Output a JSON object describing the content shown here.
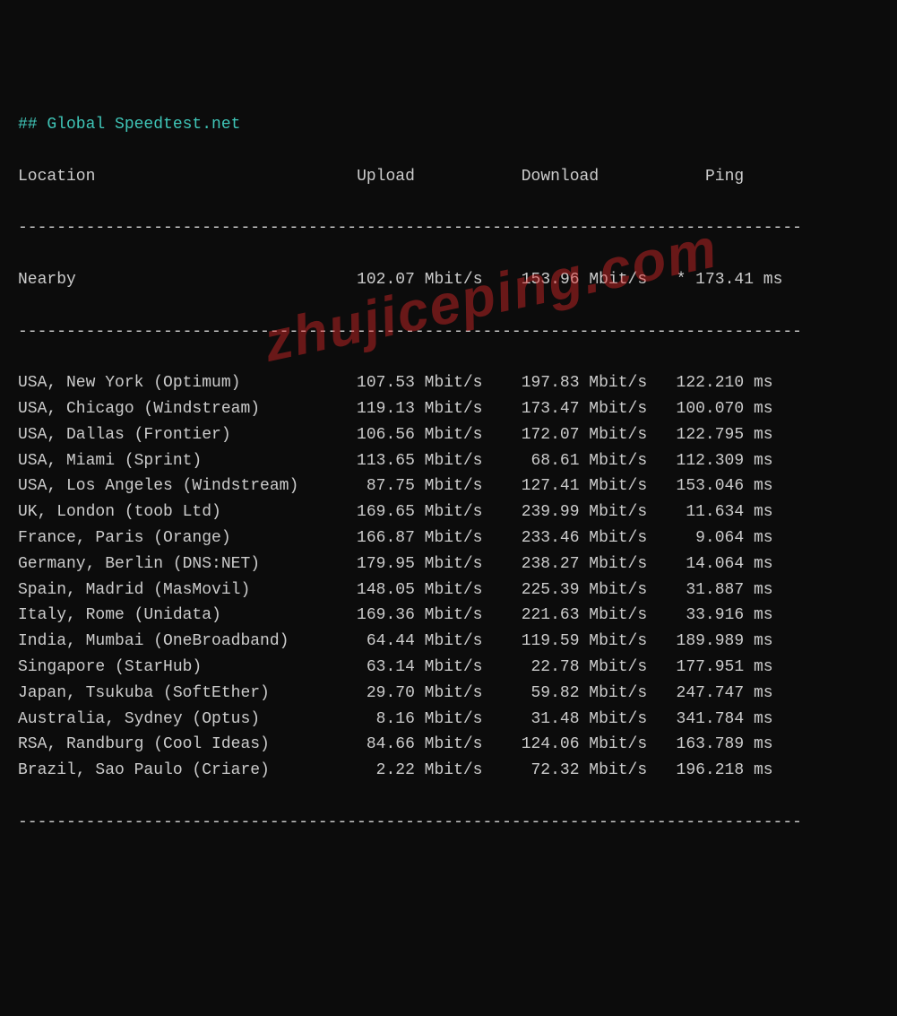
{
  "title": "## Global Speedtest.net",
  "headers": {
    "location": "Location",
    "upload": "Upload",
    "download": "Download",
    "ping": "Ping"
  },
  "nearby": {
    "label": "Nearby",
    "upload": "102.07 Mbit/s",
    "download": "153.96 Mbit/s",
    "ping": "* 173.41 ms"
  },
  "rows": [
    {
      "location": "USA, New York (Optimum)",
      "upload": "107.53 Mbit/s",
      "download": "197.83 Mbit/s",
      "ping": "122.210 ms"
    },
    {
      "location": "USA, Chicago (Windstream)",
      "upload": "119.13 Mbit/s",
      "download": "173.47 Mbit/s",
      "ping": "100.070 ms"
    },
    {
      "location": "USA, Dallas (Frontier)",
      "upload": "106.56 Mbit/s",
      "download": "172.07 Mbit/s",
      "ping": "122.795 ms"
    },
    {
      "location": "USA, Miami (Sprint)",
      "upload": "113.65 Mbit/s",
      "download": "68.61 Mbit/s",
      "ping": "112.309 ms"
    },
    {
      "location": "USA, Los Angeles (Windstream)",
      "upload": "87.75 Mbit/s",
      "download": "127.41 Mbit/s",
      "ping": "153.046 ms"
    },
    {
      "location": "UK, London (toob Ltd)",
      "upload": "169.65 Mbit/s",
      "download": "239.99 Mbit/s",
      "ping": "11.634 ms"
    },
    {
      "location": "France, Paris (Orange)",
      "upload": "166.87 Mbit/s",
      "download": "233.46 Mbit/s",
      "ping": "9.064 ms"
    },
    {
      "location": "Germany, Berlin (DNS:NET)",
      "upload": "179.95 Mbit/s",
      "download": "238.27 Mbit/s",
      "ping": "14.064 ms"
    },
    {
      "location": "Spain, Madrid (MasMovil)",
      "upload": "148.05 Mbit/s",
      "download": "225.39 Mbit/s",
      "ping": "31.887 ms"
    },
    {
      "location": "Italy, Rome (Unidata)",
      "upload": "169.36 Mbit/s",
      "download": "221.63 Mbit/s",
      "ping": "33.916 ms"
    },
    {
      "location": "India, Mumbai (OneBroadband)",
      "upload": "64.44 Mbit/s",
      "download": "119.59 Mbit/s",
      "ping": "189.989 ms"
    },
    {
      "location": "Singapore (StarHub)",
      "upload": "63.14 Mbit/s",
      "download": "22.78 Mbit/s",
      "ping": "177.951 ms"
    },
    {
      "location": "Japan, Tsukuba (SoftEther)",
      "upload": "29.70 Mbit/s",
      "download": "59.82 Mbit/s",
      "ping": "247.747 ms"
    },
    {
      "location": "Australia, Sydney (Optus)",
      "upload": "8.16 Mbit/s",
      "download": "31.48 Mbit/s",
      "ping": "341.784 ms"
    },
    {
      "location": "RSA, Randburg (Cool Ideas)",
      "upload": "84.66 Mbit/s",
      "download": "124.06 Mbit/s",
      "ping": "163.789 ms"
    },
    {
      "location": "Brazil, Sao Paulo (Criare)",
      "upload": "2.22 Mbit/s",
      "download": "72.32 Mbit/s",
      "ping": "196.218 ms"
    }
  ],
  "watermark": "zhujiceping.com",
  "divider": "---------------------------------------------------------------------------------"
}
